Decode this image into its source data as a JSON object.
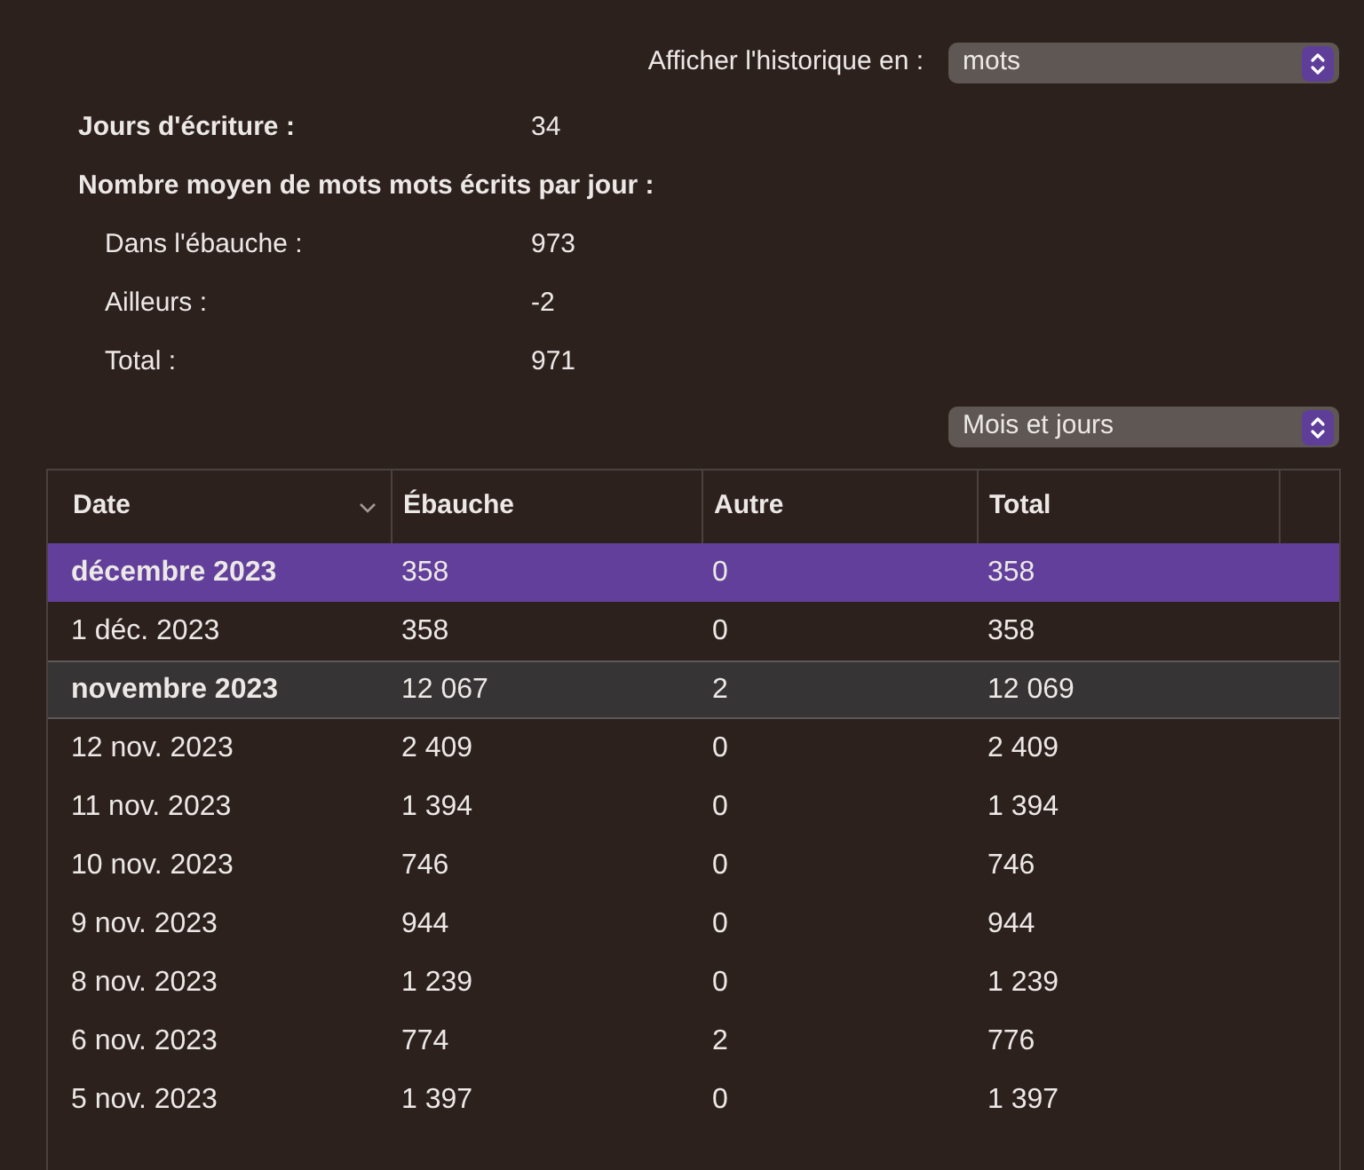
{
  "history_control": {
    "label": "Afficher l'historique en :",
    "value": "mots"
  },
  "stats": [
    {
      "kind": "heading",
      "label": "Jours d'écriture :",
      "value": "34"
    },
    {
      "kind": "heading",
      "label": "Nombre moyen de mots mots écrits par jour :"
    },
    {
      "kind": "sub",
      "label": "Dans l'ébauche :",
      "value": "973"
    },
    {
      "kind": "sub",
      "label": "Ailleurs :",
      "value": "-2"
    },
    {
      "kind": "sub",
      "label": "Total :",
      "value": "971"
    }
  ],
  "grouping_control": {
    "value": "Mois et jours"
  },
  "table": {
    "columns": [
      {
        "label": "Date",
        "sorted": true
      },
      {
        "label": "Ébauche",
        "sorted": false
      },
      {
        "label": "Autre",
        "sorted": false
      },
      {
        "label": "Total",
        "sorted": false
      }
    ],
    "rows": [
      {
        "kind": "month",
        "selected": true,
        "cells": [
          "décembre 2023",
          "358",
          "0",
          "358"
        ]
      },
      {
        "kind": "day",
        "selected": false,
        "cells": [
          "1 déc. 2023",
          "358",
          "0",
          "358"
        ]
      },
      {
        "kind": "month",
        "selected": false,
        "cells": [
          "novembre 2023",
          "12 067",
          "2",
          "12 069"
        ]
      },
      {
        "kind": "day",
        "selected": false,
        "cells": [
          "12 nov. 2023",
          "2 409",
          "0",
          "2 409"
        ]
      },
      {
        "kind": "day",
        "selected": false,
        "cells": [
          "11 nov. 2023",
          "1 394",
          "0",
          "1 394"
        ]
      },
      {
        "kind": "day",
        "selected": false,
        "cells": [
          "10 nov. 2023",
          "746",
          "0",
          "746"
        ]
      },
      {
        "kind": "day",
        "selected": false,
        "cells": [
          "9 nov. 2023",
          "944",
          "0",
          "944"
        ]
      },
      {
        "kind": "day",
        "selected": false,
        "cells": [
          "8 nov. 2023",
          "1 239",
          "0",
          "1 239"
        ]
      },
      {
        "kind": "day",
        "selected": false,
        "cells": [
          "6 nov. 2023",
          "774",
          "2",
          "776"
        ]
      },
      {
        "kind": "day",
        "selected": false,
        "cells": [
          "5 nov. 2023",
          "1 397",
          "0",
          "1 397"
        ]
      }
    ]
  }
}
